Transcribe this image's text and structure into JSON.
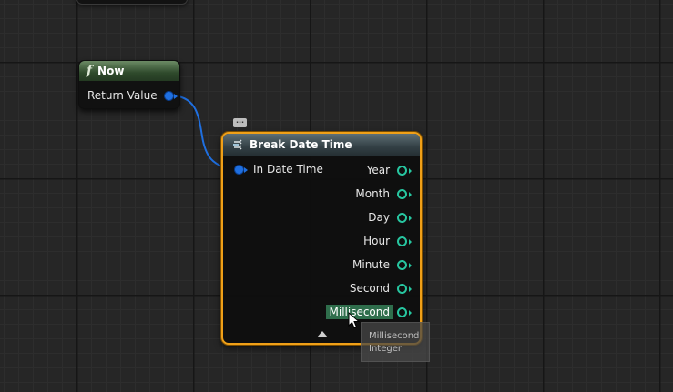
{
  "graph": {
    "now_node": {
      "title": "Now",
      "icon": "function-icon",
      "output_pin": "Return Value"
    },
    "break_node": {
      "title": "Break Date Time",
      "icon": "break-struct-icon",
      "input_pin": "In Date Time",
      "outputs": [
        "Year",
        "Month",
        "Day",
        "Hour",
        "Minute",
        "Second",
        "Millisecond"
      ],
      "highlighted_output": "Millisecond",
      "comment_bubble": "..."
    },
    "tooltip": {
      "line1": "Millisecond",
      "line2": "Integer"
    }
  },
  "colors": {
    "selection": "#f0a018",
    "datetime_pin": "#1f6fe0",
    "integer_pin": "#27c6a0"
  }
}
